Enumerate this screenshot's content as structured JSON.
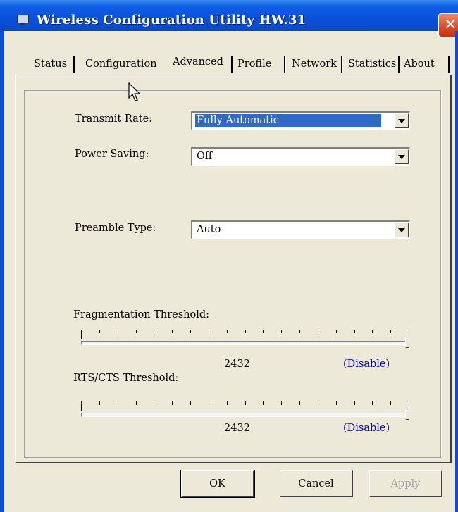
{
  "window": {
    "title": "Wireless Configuration Utility HW.31",
    "close_glyph": "✕"
  },
  "tabs": [
    {
      "label": "Status",
      "active": false
    },
    {
      "label": "Configuration",
      "active": false
    },
    {
      "label": "Advanced",
      "active": true
    },
    {
      "label": "Profile",
      "active": false
    },
    {
      "label": "Network",
      "active": false
    },
    {
      "label": "Statistics",
      "active": false
    },
    {
      "label": "About",
      "active": false
    }
  ],
  "advanced": {
    "transmit_rate": {
      "label": "Transmit Rate:",
      "value": "Fully Automatic"
    },
    "power_saving": {
      "label": "Power Saving:",
      "value": "Off"
    },
    "preamble_type": {
      "label": "Preamble Type:",
      "value": "Auto"
    },
    "fragmentation": {
      "label": "Fragmentation Threshold:",
      "value": "2432",
      "status": "(Disable)",
      "level": 1.0
    },
    "rts_cts": {
      "label": "RTS/CTS Threshold:",
      "value": "2432",
      "status": "(Disable)",
      "level": 1.0
    }
  },
  "buttons": {
    "ok": "OK",
    "cancel": "Cancel",
    "apply": "Apply"
  },
  "icons": {
    "app": "network-adapter-icon",
    "close": "close-icon",
    "dropdown": "dropdown-arrow-icon",
    "cursor": "mouse-pointer-icon"
  }
}
